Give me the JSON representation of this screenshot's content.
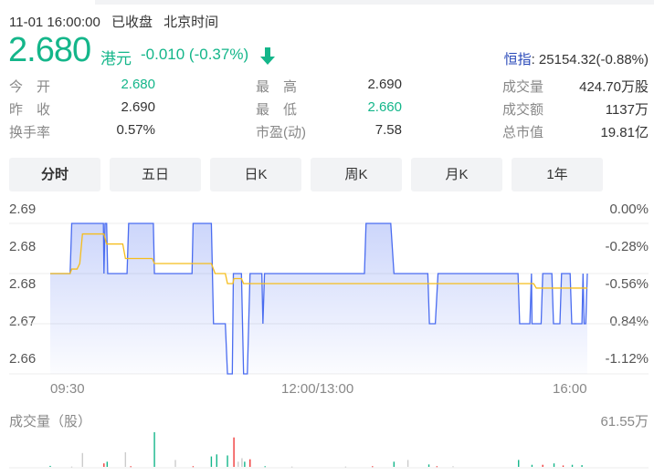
{
  "header": {
    "datetime": "11-01 16:00:00",
    "status": "已收盘",
    "timezone": "北京时间"
  },
  "quote": {
    "price": "2.680",
    "currency": "港元",
    "change": "-0.010 (-0.37%)",
    "direction_icon": "arrow-down-icon",
    "index_label": "恒指",
    "index_value": ": 25154.32(-0.88%)"
  },
  "stats": [
    {
      "label": "今　开",
      "value": "2.680",
      "color": "#14b68a"
    },
    {
      "label": "昨　收",
      "value": "2.690",
      "color": "#333333"
    },
    {
      "label": "换手率",
      "value": "0.57%",
      "color": "#333333"
    },
    {
      "label": "最　高",
      "value": "2.690",
      "color": "#333333"
    },
    {
      "label": "最　低",
      "value": "2.660",
      "color": "#14b68a"
    },
    {
      "label": "市盈(动)",
      "value": "7.58",
      "color": "#333333"
    },
    {
      "label": "成交量",
      "value": "424.70万股",
      "color": "#333333"
    },
    {
      "label": "成交额",
      "value": "1137万",
      "color": "#333333"
    },
    {
      "label": "总市值",
      "value": "19.81亿",
      "color": "#333333"
    }
  ],
  "tabs": [
    "分时",
    "五日",
    "日K",
    "周K",
    "月K",
    "1年"
  ],
  "active_tab": 0,
  "colors": {
    "up": "#f03a3a",
    "down": "#14b68a",
    "price_line": "#4a6cf0",
    "avg_line": "#f5bd1c",
    "neutral": "#cccccc"
  },
  "chart_data": {
    "type": "line",
    "y_ticks_left": [
      "2.69",
      "2.68",
      "2.68",
      "2.67",
      "2.66"
    ],
    "y_ticks_right": [
      "0.00%",
      "-0.28%",
      "-0.56%",
      "0.84%",
      "-1.12%"
    ],
    "x_ticks": [
      "09:30",
      "12:00/13:00",
      "16:00"
    ],
    "ylim": [
      2.66,
      2.69
    ],
    "price_series": [
      [
        0,
        2.68
      ],
      [
        0.037,
        2.68
      ],
      [
        0.04,
        2.69
      ],
      [
        0.099,
        2.69
      ],
      [
        0.1,
        2.68
      ],
      [
        0.102,
        2.69
      ],
      [
        0.105,
        2.69
      ],
      [
        0.107,
        2.68
      ],
      [
        0.143,
        2.68
      ],
      [
        0.146,
        2.69
      ],
      [
        0.192,
        2.69
      ],
      [
        0.194,
        2.68
      ],
      [
        0.264,
        2.68
      ],
      [
        0.266,
        2.69
      ],
      [
        0.3,
        2.69
      ],
      [
        0.304,
        2.67
      ],
      [
        0.326,
        2.67
      ],
      [
        0.33,
        2.66
      ],
      [
        0.339,
        2.66
      ],
      [
        0.341,
        2.68
      ],
      [
        0.356,
        2.68
      ],
      [
        0.36,
        2.66
      ],
      [
        0.367,
        2.66
      ],
      [
        0.372,
        2.68
      ],
      [
        0.394,
        2.68
      ],
      [
        0.396,
        2.67
      ],
      [
        0.399,
        2.68
      ],
      [
        0.585,
        2.68
      ],
      [
        0.588,
        2.69
      ],
      [
        0.634,
        2.69
      ],
      [
        0.64,
        2.68
      ],
      [
        0.703,
        2.68
      ],
      [
        0.706,
        2.67
      ],
      [
        0.717,
        2.67
      ],
      [
        0.722,
        2.68
      ],
      [
        0.871,
        2.68
      ],
      [
        0.874,
        2.67
      ],
      [
        0.893,
        2.67
      ],
      [
        0.896,
        2.68
      ],
      [
        0.897,
        2.67
      ],
      [
        0.914,
        2.67
      ],
      [
        0.917,
        2.68
      ],
      [
        0.934,
        2.68
      ],
      [
        0.937,
        2.67
      ],
      [
        0.949,
        2.67
      ],
      [
        0.952,
        2.68
      ],
      [
        0.968,
        2.68
      ],
      [
        0.971,
        2.67
      ],
      [
        0.99,
        2.67
      ],
      [
        0.992,
        2.68
      ],
      [
        0.994,
        2.67
      ],
      [
        0.997,
        2.67
      ],
      [
        1,
        2.68
      ]
    ],
    "avg_series": [
      [
        0,
        2.68
      ],
      [
        0.037,
        2.68
      ],
      [
        0.04,
        2.6809
      ],
      [
        0.05,
        2.6809
      ],
      [
        0.055,
        2.682
      ],
      [
        0.06,
        2.6879
      ],
      [
        0.1,
        2.6879
      ],
      [
        0.105,
        2.6859
      ],
      [
        0.135,
        2.6859
      ],
      [
        0.14,
        2.683
      ],
      [
        0.19,
        2.683
      ],
      [
        0.194,
        2.682
      ],
      [
        0.3,
        2.682
      ],
      [
        0.307,
        2.68
      ],
      [
        0.326,
        2.68
      ],
      [
        0.33,
        2.678
      ],
      [
        0.34,
        2.678
      ],
      [
        0.342,
        2.679
      ],
      [
        0.356,
        2.679
      ],
      [
        0.36,
        2.678
      ],
      [
        0.9,
        2.678
      ],
      [
        0.905,
        2.6771
      ],
      [
        1,
        2.6771
      ]
    ],
    "volume_label": "成交量（股）",
    "volume_max": "61.55万",
    "volume_max_value": 61.55,
    "volume": [
      [
        0,
        1.8,
        "down"
      ],
      [
        0.04,
        0.6,
        "neutral"
      ],
      [
        0.06,
        24.6,
        "neutral"
      ],
      [
        0.1,
        6.2,
        "up"
      ],
      [
        0.106,
        9.2,
        "down"
      ],
      [
        0.14,
        25.9,
        "neutral"
      ],
      [
        0.15,
        1.2,
        "up"
      ],
      [
        0.194,
        61.55,
        "down"
      ],
      [
        0.233,
        12.3,
        "neutral"
      ],
      [
        0.266,
        1.2,
        "up"
      ],
      [
        0.3,
        18.5,
        "down"
      ],
      [
        0.31,
        22.2,
        "down"
      ],
      [
        0.33,
        20.3,
        "down"
      ],
      [
        0.342,
        52.3,
        "up"
      ],
      [
        0.35,
        9.2,
        "neutral"
      ],
      [
        0.357,
        15.4,
        "neutral"
      ],
      [
        0.362,
        9.2,
        "down"
      ],
      [
        0.372,
        13.5,
        "up"
      ],
      [
        0.4,
        1.2,
        "down"
      ],
      [
        0.45,
        0.6,
        "neutral"
      ],
      [
        0.55,
        0.6,
        "neutral"
      ],
      [
        0.6,
        1.2,
        "up"
      ],
      [
        0.64,
        9.2,
        "down"
      ],
      [
        0.666,
        12.3,
        "neutral"
      ],
      [
        0.705,
        4.3,
        "down"
      ],
      [
        0.72,
        1.2,
        "up"
      ],
      [
        0.75,
        1.2,
        "neutral"
      ],
      [
        0.872,
        12.3,
        "down"
      ],
      [
        0.897,
        3.7,
        "down"
      ],
      [
        0.917,
        3.7,
        "up"
      ],
      [
        0.938,
        6.2,
        "down"
      ],
      [
        0.955,
        2.5,
        "up"
      ],
      [
        0.972,
        3.7,
        "down"
      ],
      [
        0.99,
        3.1,
        "down"
      ]
    ]
  }
}
